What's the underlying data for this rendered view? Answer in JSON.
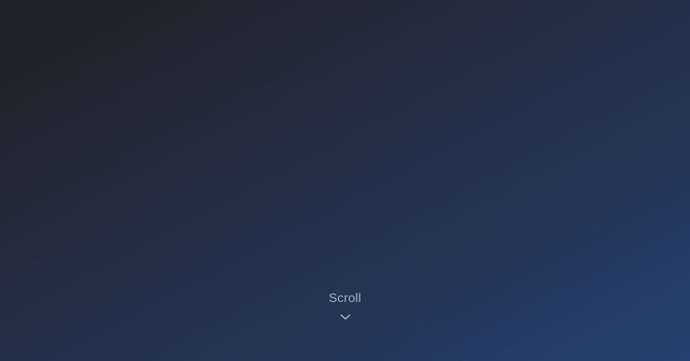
{
  "hero": {
    "scroll_label": "Scroll",
    "scroll_icon": "chevron-down-icon"
  },
  "colors": {
    "gradient_start": "#1f2127",
    "gradient_end": "#264272",
    "scroll_text": "#a4afc0"
  }
}
